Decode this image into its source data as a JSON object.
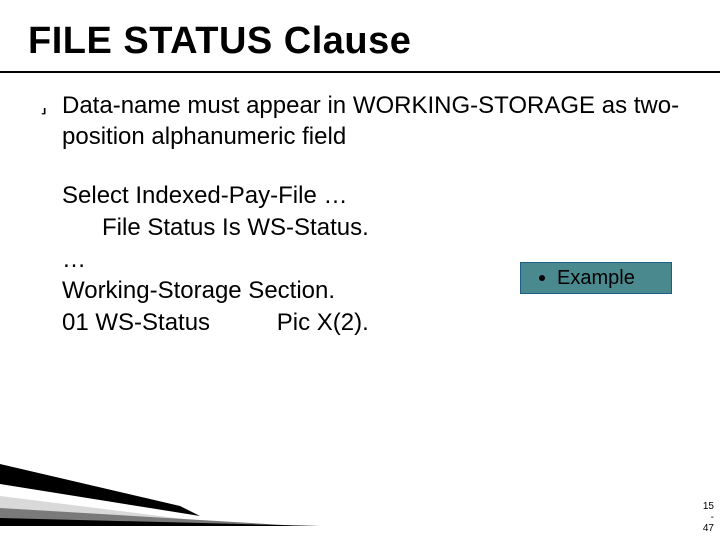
{
  "title": "FILE STATUS Clause",
  "bullet": {
    "marker": "⸥",
    "text": "Data-name must appear in WORKING-STORAGE as two-position alphanumeric field"
  },
  "code": "Select Indexed-Pay-File …\n      File Status Is WS-Status.\n…\nWorking-Storage Section.\n01 WS-Status          Pic X(2).",
  "example_label": "Example",
  "page": {
    "chapter": "15",
    "sep": "-",
    "num": "47"
  }
}
